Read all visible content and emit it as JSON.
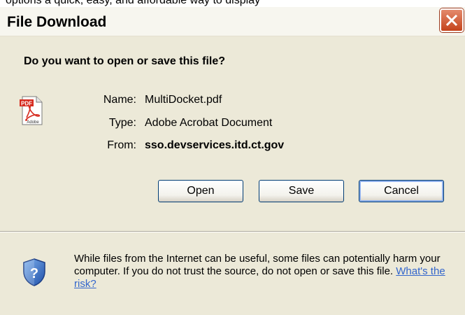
{
  "top_strip_text": "options a quick, easy, and affordable way to display",
  "window": {
    "title": "File Download"
  },
  "dialog": {
    "question": "Do you want to open or save this file?",
    "file": {
      "name_label": "Name:",
      "name_value": "MultiDocket.pdf",
      "type_label": "Type:",
      "type_value": "Adobe Acrobat Document",
      "from_label": "From:",
      "from_value": "sso.devservices.itd.ct.gov"
    },
    "icon_text": {
      "pdf": "PDF",
      "adobe": "Adobe"
    },
    "buttons": {
      "open": "Open",
      "save": "Save",
      "cancel": "Cancel"
    }
  },
  "warning": {
    "text": "While files from the Internet can be useful, some files can potentially harm your computer. If you do not trust the source, do not open or save this file. ",
    "link": "What's the risk?"
  },
  "colors": {
    "dialog_bg": "#ece9d8",
    "close_button": "#c4431b",
    "link": "#3366cc",
    "pdf_red": "#d62b1f"
  },
  "icons": {
    "close": "close-icon",
    "file": "pdf-file-icon",
    "security": "security-shield-icon"
  }
}
